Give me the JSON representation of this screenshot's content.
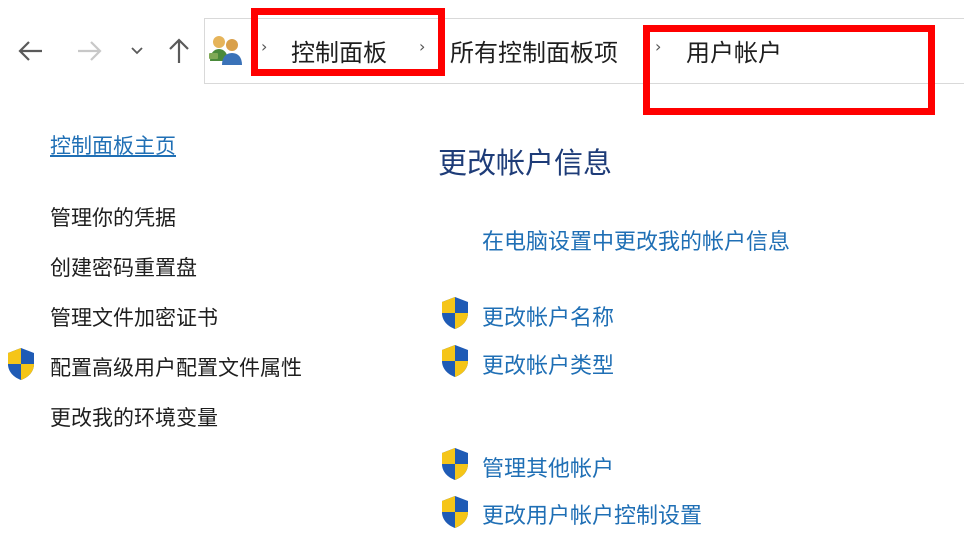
{
  "nav": {
    "back_icon": "back-arrow-icon",
    "forward_icon": "forward-arrow-icon",
    "recent_icon": "chevron-down-icon",
    "up_icon": "up-arrow-icon"
  },
  "address_bar": {
    "location_icon": "user-accounts-icon",
    "breadcrumbs": [
      "控制面板",
      "所有控制面板项",
      "用户帐户"
    ]
  },
  "sidebar": {
    "home_link": "控制面板主页",
    "links": [
      {
        "label": "管理你的凭据",
        "icon": null
      },
      {
        "label": "创建密码重置盘",
        "icon": null
      },
      {
        "label": "管理文件加密证书",
        "icon": null
      },
      {
        "label": "配置高级用户配置文件属性",
        "icon": "uac-shield-icon"
      },
      {
        "label": "更改我的环境变量",
        "icon": null
      }
    ]
  },
  "main": {
    "heading": "更改帐户信息",
    "tasks": [
      {
        "label": "在电脑设置中更改我的帐户信息",
        "icon": null
      },
      {
        "label": "更改帐户名称",
        "icon": "uac-shield-icon"
      },
      {
        "label": "更改帐户类型",
        "icon": "uac-shield-icon"
      },
      {
        "label": "管理其他帐户",
        "icon": "uac-shield-icon"
      },
      {
        "label": "更改用户帐户控制设置",
        "icon": "uac-shield-icon"
      }
    ]
  },
  "annotations": {
    "highlight_color": "#ff0000"
  },
  "colors": {
    "link": "#1f6fb5",
    "heading": "#1e3c78",
    "text": "#1e1e1e"
  }
}
